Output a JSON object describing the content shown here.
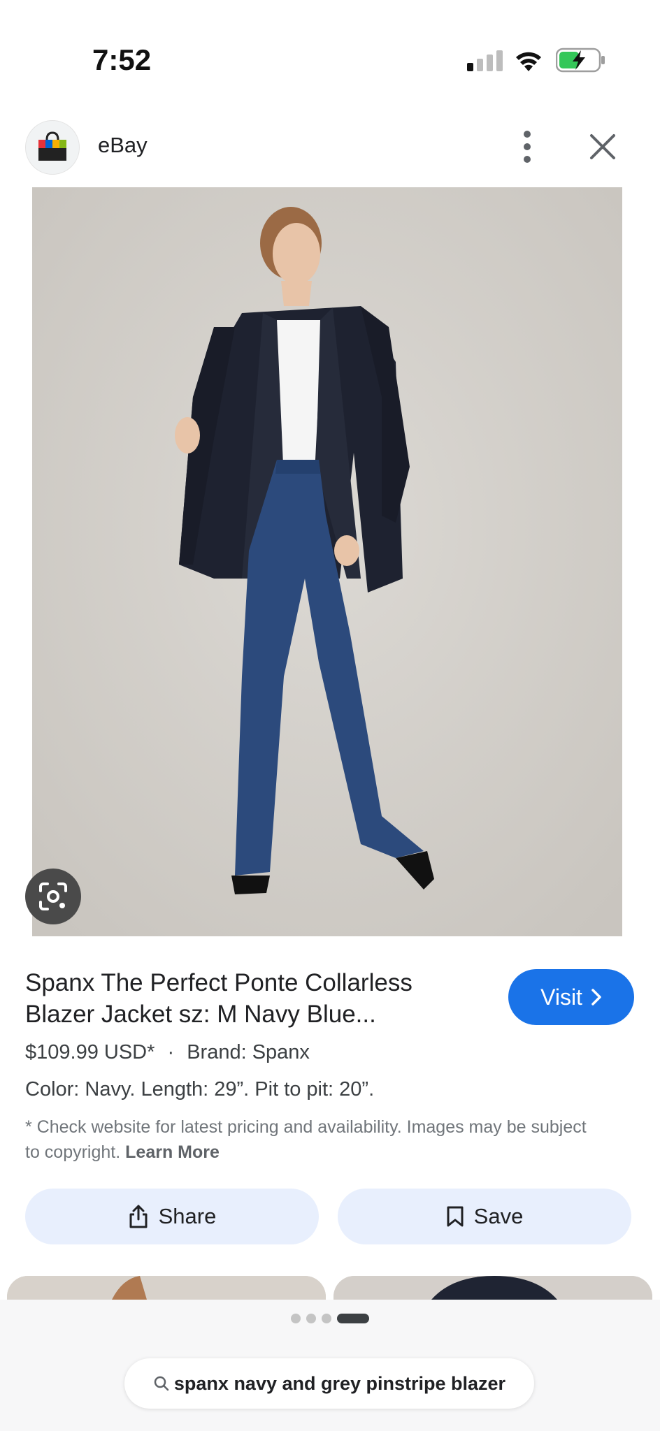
{
  "status_bar": {
    "time": "7:52"
  },
  "header": {
    "site_name": "eBay"
  },
  "product": {
    "title": "Spanx The Perfect Ponte Collarless Blazer Jacket sz: M Navy Blue...",
    "visit_label": "Visit",
    "price": "$109.99 USD*",
    "separator": "·",
    "brand": "Brand: Spanx",
    "description": "Color: Navy. Length: 29”. Pit to pit: 20”.",
    "disclaimer": "* Check website for latest pricing and availability. Images may be subject to copyright.",
    "learn_more": "Learn More"
  },
  "actions": {
    "share_label": "Share",
    "save_label": "Save"
  },
  "search": {
    "query": "spanx navy and grey pinstripe blazer"
  },
  "colors": {
    "accent": "#1a73e8",
    "action_bg": "#e8effd"
  },
  "pager": {
    "current_index": 3,
    "total": 4
  }
}
